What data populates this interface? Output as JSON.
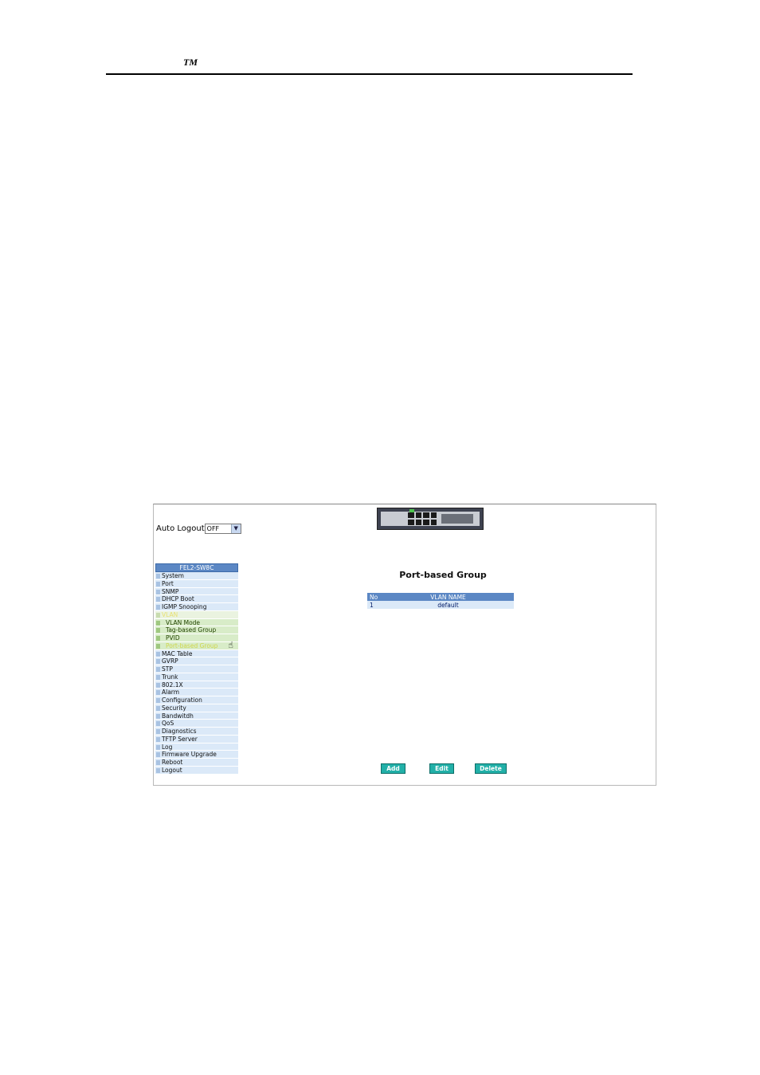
{
  "doc": {
    "tm": "TM"
  },
  "ui": {
    "auto_logout": {
      "label": "Auto Logout",
      "value": "OFF"
    },
    "menu": {
      "header": "FEL2-SW8C",
      "items": [
        "System",
        "Port",
        "SNMP",
        "DHCP Boot",
        "IGMP Snooping",
        "VLAN",
        "VLAN Mode",
        "Tag-based Group",
        "PVID",
        "Port-based Group",
        "MAC Table",
        "GVRP",
        "STP",
        "Trunk",
        "802.1X",
        "Alarm",
        "Configuration",
        "Security",
        "Bandwitdh",
        "QoS",
        "Diagnostics",
        "TFTP Server",
        "Log",
        "Firmware Upgrade",
        "Reboot",
        "Logout"
      ]
    },
    "page_title": "Port-based Group",
    "table": {
      "headers": [
        "No",
        "VLAN NAME"
      ],
      "rows": [
        {
          "no": "1",
          "name": "default"
        }
      ]
    },
    "buttons": {
      "add": "Add",
      "edit": "Edit",
      "delete": "Delete"
    },
    "colors": {
      "header": "#5b87c4",
      "row": "#dbe9f8",
      "button": "#22b0a8"
    }
  }
}
